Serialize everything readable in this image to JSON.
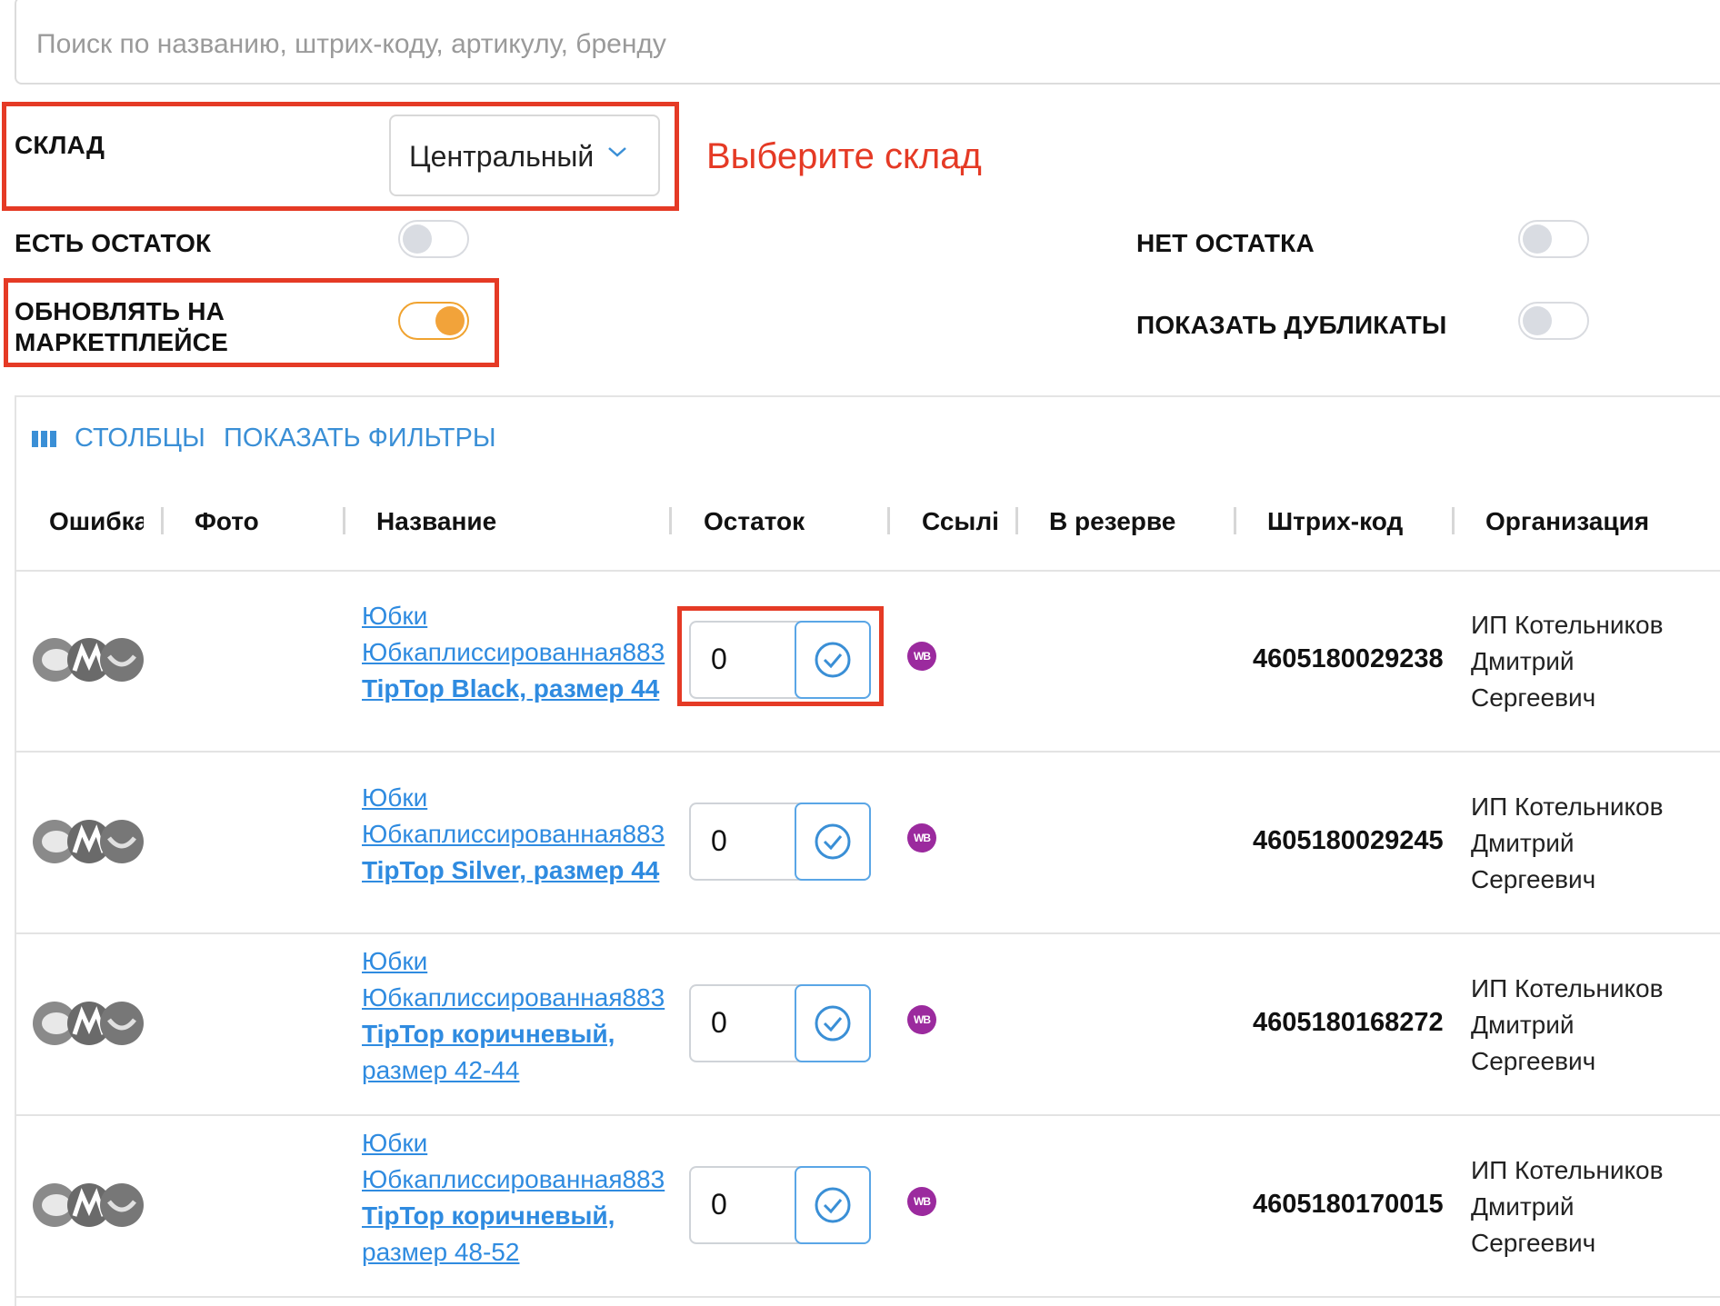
{
  "search": {
    "placeholder": "Поиск по названию, штрих-коду, артикулу, бренду"
  },
  "filters": {
    "warehouse_label": "СКЛАД",
    "warehouse_value": "Центральный",
    "warehouse_hint": "Выберите склад",
    "in_stock_label": "ЕСТЬ ОСТАТОК",
    "in_stock_on": false,
    "no_stock_label": "НЕТ ОСТАТКА",
    "no_stock_on": false,
    "update_marketplace_label_line1": "ОБНОВЛЯТЬ НА",
    "update_marketplace_label_line2": "МАРКЕТПЛЕЙСЕ",
    "update_marketplace_on": true,
    "show_duplicates_label": "ПОКАЗАТЬ ДУБЛИКАТЫ",
    "show_duplicates_on": false
  },
  "toolbar": {
    "columns_label": "СТОЛБЦЫ",
    "show_filters_label": "ПОКАЗАТЬ ФИЛЬТРЫ"
  },
  "table": {
    "headers": [
      "Ошибка",
      "Фото",
      "Название",
      "Остаток",
      "Ссылка",
      "В резерве",
      "Штрих-код",
      "Организация"
    ],
    "header_display": [
      "Ошибка",
      "Фото",
      "Название",
      "Остаток",
      "Ссылі",
      "В резерве",
      "Штрих-код",
      "Организация"
    ],
    "rows": [
      {
        "name_line1": "Юбки",
        "name_line2": "Юбкаплиссированная883",
        "name_line3": "TipTop Black, размер 44",
        "name_line4": "",
        "stock": "0",
        "link_badge": "WB",
        "barcode": "4605180029238",
        "org_line1": "ИП Котельников",
        "org_line2": "Дмитрий",
        "org_line3": "Сергеевич"
      },
      {
        "name_line1": "Юбки",
        "name_line2": "Юбкаплиссированная883",
        "name_line3": "TipTop Silver, размер 44",
        "name_line4": "",
        "stock": "0",
        "link_badge": "WB",
        "barcode": "4605180029245",
        "org_line1": "ИП Котельников",
        "org_line2": "Дмитрий",
        "org_line3": "Сергеевич"
      },
      {
        "name_line1": "Юбки",
        "name_line2": "Юбкаплиссированная883",
        "name_line3": "TipTop коричневый,",
        "name_line4": "размер 42-44",
        "stock": "0",
        "link_badge": "WB",
        "barcode": "4605180168272",
        "org_line1": "ИП Котельников",
        "org_line2": "Дмитрий",
        "org_line3": "Сергеевич"
      },
      {
        "name_line1": "Юбки",
        "name_line2": "Юбкаплиссированная883",
        "name_line3": "TipTop коричневый,",
        "name_line4": "размер 48-52",
        "stock": "0",
        "link_badge": "WB",
        "barcode": "4605180170015",
        "org_line1": "ИП Котельников",
        "org_line2": "Дмитрий",
        "org_line3": "Сергеевич"
      }
    ]
  },
  "colors": {
    "accent": "#3a8fd6",
    "highlight": "#e53a25",
    "toggle_on": "#f2a33a",
    "wb_badge": "#9b2a9e"
  }
}
